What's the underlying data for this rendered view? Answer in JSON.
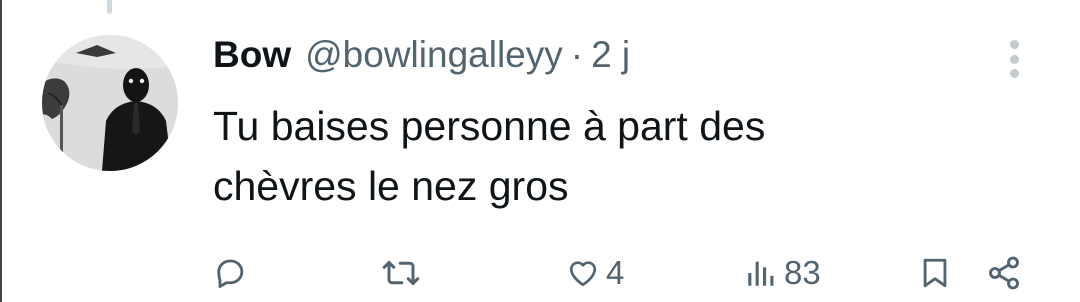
{
  "tweet": {
    "display_name": "Bow",
    "handle": "@bowlingalleyy",
    "separator": "·",
    "time": "2 j",
    "text_line1": "Tu baises personne à part des",
    "text_line2": "chèvres le nez gros"
  },
  "actions": {
    "reply_icon": "reply-icon",
    "retweet_icon": "retweet-icon",
    "like_icon": "heart-icon",
    "like_count": "4",
    "views_icon": "views-icon",
    "views_count": "83",
    "bookmark_icon": "bookmark-icon",
    "share_icon": "share-icon"
  },
  "colors": {
    "text": "#0f1419",
    "muted": "#536471",
    "thread_line": "#cfd9de"
  }
}
